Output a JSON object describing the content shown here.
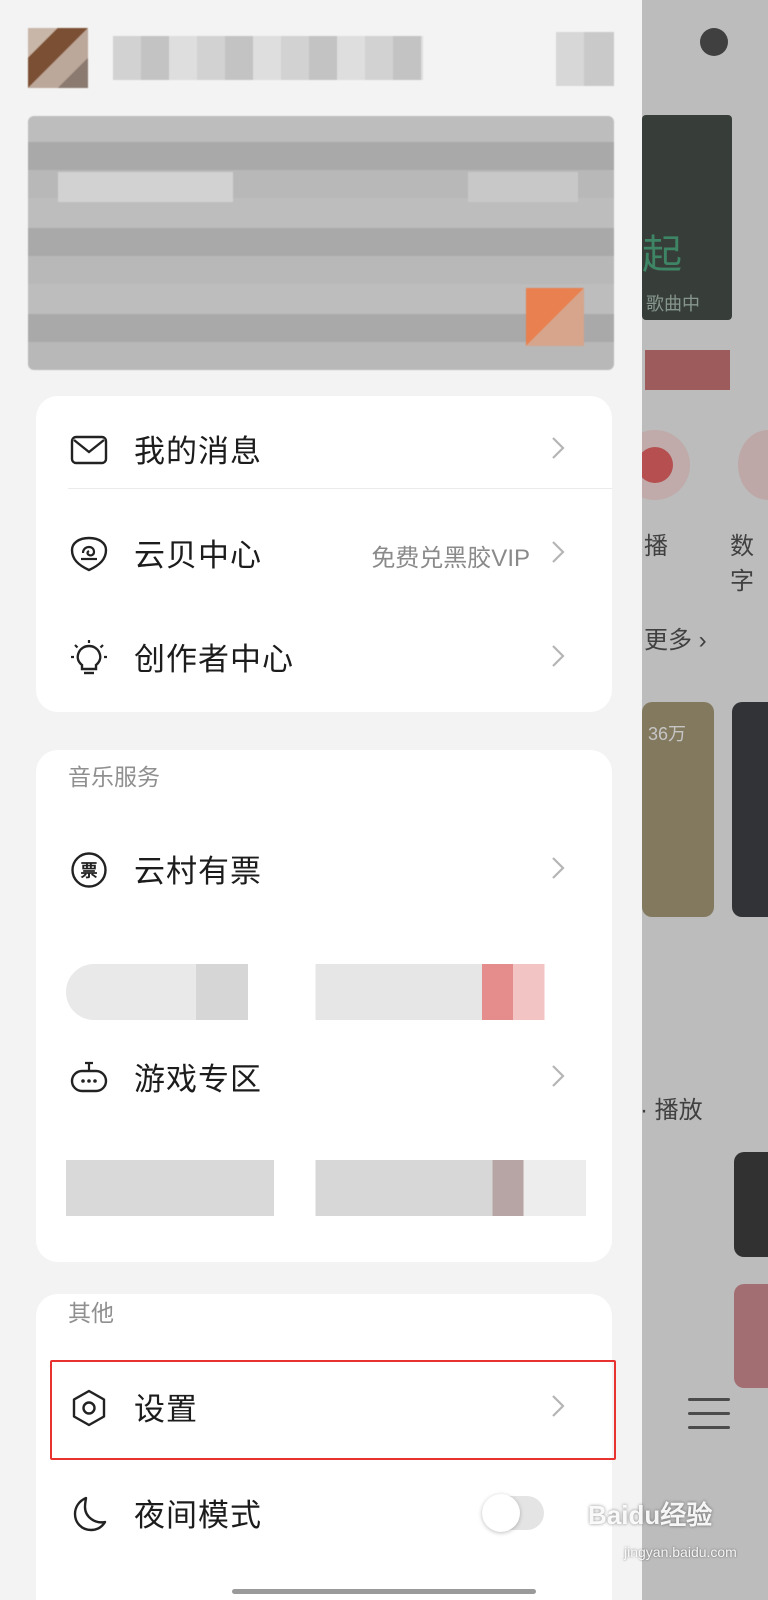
{
  "background_app": {
    "cover_text": "起",
    "cover_sub": "歌曲中",
    "label_play": "播",
    "label_digital": "数字",
    "more_link": "更多",
    "play_count": "36万",
    "playlist_label": "· 播放"
  },
  "drawer": {
    "account_menu": [
      {
        "label": "我的消息",
        "icon": "mail-icon"
      },
      {
        "label": "云贝中心",
        "sub": "免费兑黑胶VIP",
        "icon": "cloud-shell-icon"
      },
      {
        "label": "创作者中心",
        "icon": "lightbulb-icon"
      }
    ],
    "music_services": {
      "title": "音乐服务",
      "items": [
        {
          "label": "云村有票",
          "icon": "ticket-icon"
        },
        {
          "label": "游戏专区",
          "icon": "gamepad-icon"
        }
      ]
    },
    "others": {
      "title": "其他",
      "items": [
        {
          "label": "设置",
          "icon": "settings-icon"
        },
        {
          "label": "夜间模式",
          "icon": "moon-icon"
        }
      ]
    }
  },
  "watermark": {
    "brand": "Baidu经验",
    "url": "jingyan.baidu.com"
  },
  "colors": {
    "highlight_border": "#e8322f",
    "drawer_bg": "#f3f3f3",
    "card_bg": "#ffffff"
  }
}
